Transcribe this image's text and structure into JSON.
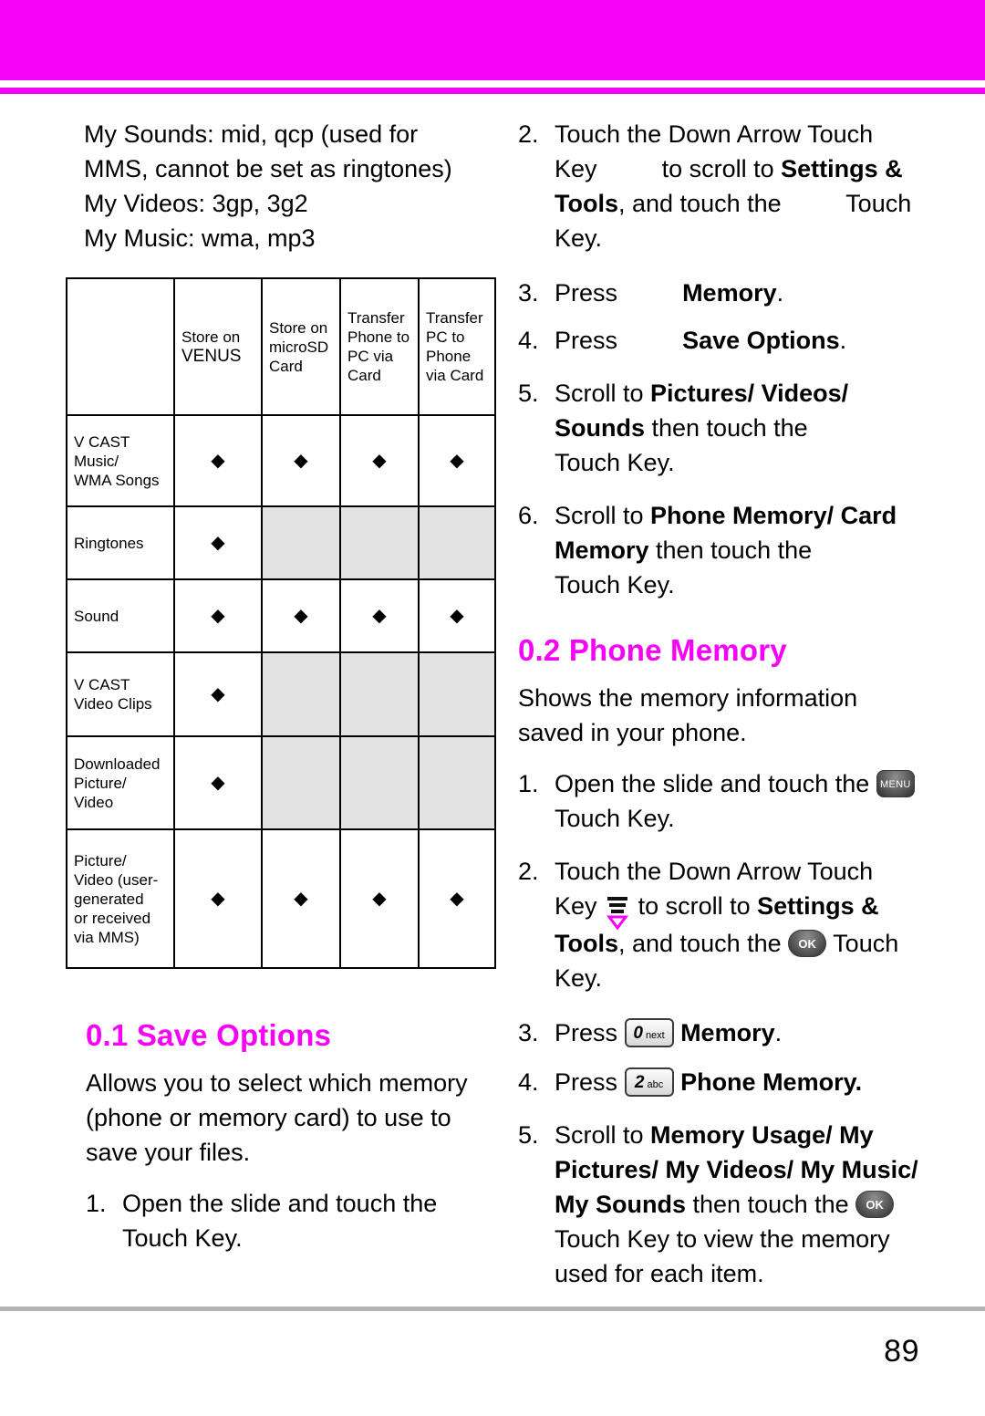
{
  "page": {
    "number": "89",
    "accent_color": "#f602f6"
  },
  "left": {
    "intro_lines": [
      "My Sounds: mid, qcp (used for",
      "MMS, cannot be set as ringtones)",
      "My Videos: 3gp, 3g2",
      "My Music: wma, mp3"
    ],
    "table": {
      "headers": [
        "",
        "Store on VENUS",
        "Store on microSD Card",
        "Transfer Phone to PC via Card",
        "Transfer PC to Phone via Card"
      ],
      "header_parts": {
        "c1_a": "Store on",
        "c1_b": "VENUS",
        "c2_a": "Store on",
        "c2_b": "microSD",
        "c2_c": "Card",
        "c3_a": "Transfer",
        "c3_b": "Phone to",
        "c3_c": "PC via",
        "c3_d": "Card",
        "c4_a": "Transfer",
        "c4_b": "PC to",
        "c4_c": "Phone",
        "c4_d": "via Card"
      },
      "mark": "◆",
      "rows": [
        {
          "label_lines": [
            "V CAST",
            "Music/",
            "WMA Songs"
          ],
          "cells": [
            "mark",
            "mark",
            "mark",
            "mark"
          ]
        },
        {
          "label_lines": [
            "Ringtones"
          ],
          "cells": [
            "mark",
            "shaded",
            "shaded",
            "shaded"
          ]
        },
        {
          "label_lines": [
            "Sound"
          ],
          "cells": [
            "mark",
            "mark",
            "mark",
            "mark"
          ]
        },
        {
          "label_lines": [
            "V CAST",
            "Video Clips"
          ],
          "cells": [
            "mark",
            "shaded",
            "shaded",
            "shaded"
          ]
        },
        {
          "label_lines": [
            "Downloaded",
            "Picture/",
            "Video"
          ],
          "cells": [
            "mark",
            "shaded",
            "shaded",
            "shaded"
          ]
        },
        {
          "label_lines": [
            "Picture/",
            "Video (user-",
            "generated",
            "or received",
            "via MMS)"
          ],
          "cells": [
            "mark",
            "mark",
            "mark",
            "mark"
          ]
        }
      ]
    },
    "section": {
      "title": "0.1 Save Options",
      "body_lines": [
        "Allows you to select which memory",
        "(phone or memory card) to use to",
        "save your files."
      ],
      "steps": [
        {
          "num": "1.",
          "line1": "Open the slide and touch the",
          "line2": "Touch Key."
        }
      ]
    }
  },
  "right": {
    "steps_top": [
      {
        "num": "2.",
        "l1": "Touch the Down Arrow Touch",
        "l2_a": "Key",
        "l2_b": "to scroll to ",
        "l2_bold": "Settings &",
        "l3_bold": "Tools",
        "l3_a": ", and touch the",
        "l3_b": "Touch",
        "l4": "Key."
      },
      {
        "num": "3.",
        "a": "Press",
        "bold": "Memory",
        "tail": "."
      },
      {
        "num": "4.",
        "a": "Press",
        "bold": "Save Options",
        "tail": "."
      },
      {
        "num": "5.",
        "a": "Scroll to ",
        "bold1": "Pictures/ Videos/",
        "bold2": "Sounds",
        "b": " then touch the",
        "c": "Touch Key."
      },
      {
        "num": "6.",
        "a": "Scroll to ",
        "bold1": "Phone Memory/ Card",
        "bold2": "Memory",
        "b": " then touch the",
        "c": "Touch Key."
      }
    ],
    "section": {
      "title": "0.2 Phone Memory",
      "body_lines": [
        "Shows the memory information",
        "saved in your phone."
      ]
    },
    "steps_bottom": [
      {
        "num": "1.",
        "l1": "Open the slide and touch the",
        "key": "menu-key",
        "l2": "Touch Key."
      },
      {
        "num": "2.",
        "l1": "Touch the Down Arrow Touch",
        "l2_a": "Key",
        "l2_b": "to scroll to ",
        "l2_bold": "Settings &",
        "l3_bold": "Tools",
        "l3_a": ", and touch the",
        "l3_b": "Touch",
        "l4": "Key."
      },
      {
        "num": "3.",
        "a": "Press",
        "key_big": "0",
        "key_small": "next",
        "bold": "Memory",
        "tail": "."
      },
      {
        "num": "4.",
        "a": "Press",
        "key_big": "2",
        "key_small": "abc",
        "bold": "Phone Memory.",
        "tail": ""
      },
      {
        "num": "5.",
        "a": "Scroll to ",
        "bold1": "Memory Usage/ My",
        "bold2": "Pictures/ My Videos/ My Music/",
        "bold3": "My Sounds",
        "b": " then touch the",
        "c": "Touch Key to view the memory",
        "d": "used for each item."
      }
    ],
    "icons": {
      "menu_label": "MENU",
      "ok_label": "OK"
    }
  }
}
